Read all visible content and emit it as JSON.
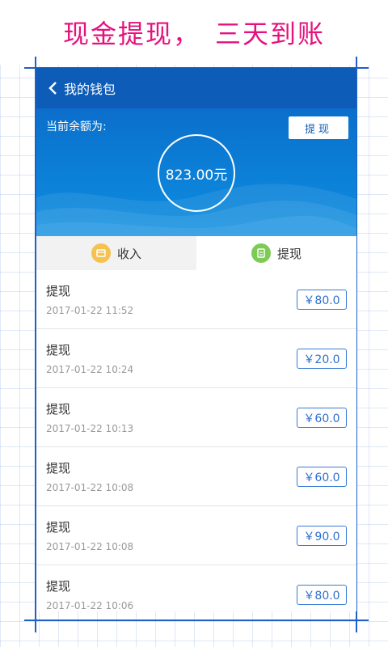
{
  "banner": {
    "left_text": "现金提现，",
    "right_text": "三天到账"
  },
  "header": {
    "title": "我的钱包",
    "balance_label": "当前余额为:",
    "withdraw_button": "提现",
    "balance_amount": "823.00元"
  },
  "tabs": [
    {
      "label": "收入",
      "icon": "wallet-icon",
      "color": "#f5c24f"
    },
    {
      "label": "提现",
      "icon": "receipt-icon",
      "color": "#7dcb57"
    }
  ],
  "records": [
    {
      "title": "提现",
      "time": "2017-01-22 11:52",
      "amount": "￥80.0"
    },
    {
      "title": "提现",
      "time": "2017-01-22 10:24",
      "amount": "￥20.0"
    },
    {
      "title": "提现",
      "time": "2017-01-22 10:13",
      "amount": "￥60.0"
    },
    {
      "title": "提现",
      "time": "2017-01-22 10:08",
      "amount": "￥60.0"
    },
    {
      "title": "提现",
      "time": "2017-01-22 10:08",
      "amount": "￥90.0"
    },
    {
      "title": "提现",
      "time": "2017-01-22 10:06",
      "amount": "￥80.0"
    }
  ],
  "colors": {
    "banner_text": "#e5117e",
    "header_blue": "#0d5cb8",
    "amount_border": "#3a7bd5"
  }
}
